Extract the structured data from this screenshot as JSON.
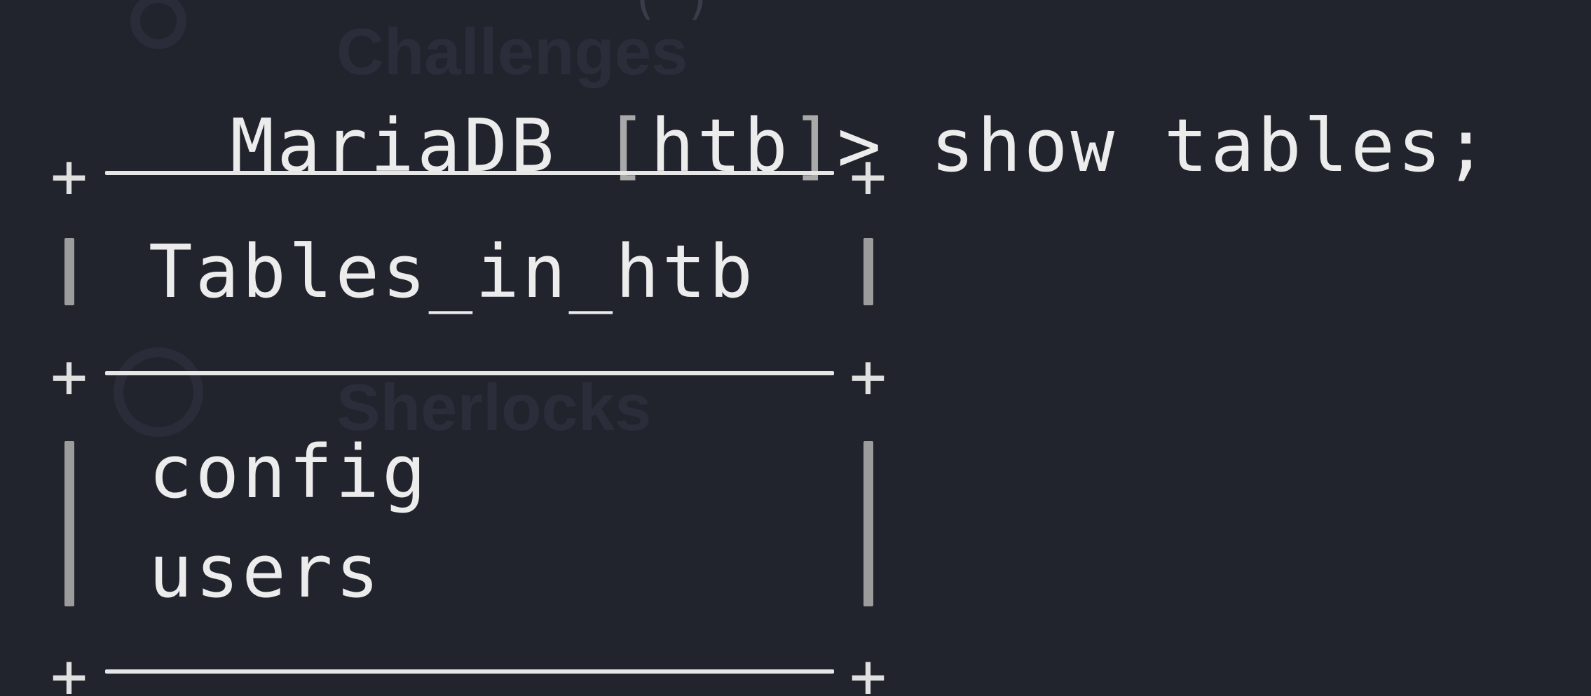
{
  "terminal": {
    "prompt": "MariaDB [htb]> ",
    "prompt_db": "MariaDB ",
    "prompt_open": "[",
    "prompt_name": "htb",
    "prompt_close": "]",
    "prompt_arrow": "> ",
    "command": "show tables;"
  },
  "result_table": {
    "header": "Tables_in_htb",
    "rows": [
      "config",
      "users"
    ]
  },
  "background_watermark": {
    "top_label": "Challenges",
    "mid_label": "Sherlocks"
  }
}
